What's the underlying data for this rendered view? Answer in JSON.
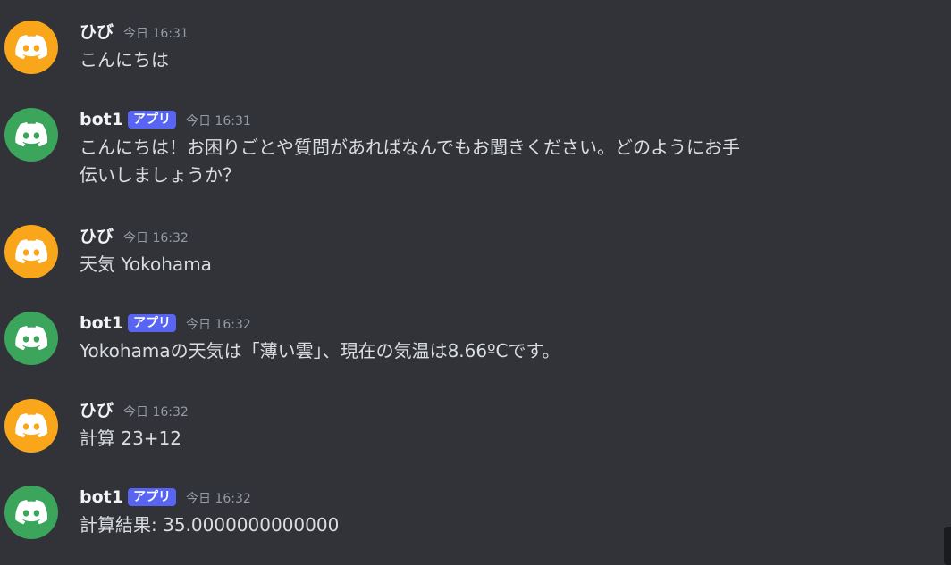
{
  "colors": {
    "background": "#313338",
    "avatar_orange": "#faa61a",
    "avatar_green": "#3ba55c",
    "badge": "#5865f2"
  },
  "messages": [
    {
      "author": "ひび",
      "is_app": false,
      "badge": "",
      "timestamp": "今日 16:31",
      "avatar_icon": "discord-logo-icon",
      "avatar_color": "#faa61a",
      "lines": [
        "こんにちは"
      ]
    },
    {
      "author": "bot1",
      "is_app": true,
      "badge": "アプリ",
      "timestamp": "今日 16:31",
      "avatar_icon": "discord-logo-icon",
      "avatar_color": "#3ba55c",
      "lines": [
        "こんにちは！お困りごとや質問があればなんでもお聞きください。どのようにお手",
        "伝いしましょうか？"
      ]
    },
    {
      "author": "ひび",
      "is_app": false,
      "badge": "",
      "timestamp": "今日 16:32",
      "avatar_icon": "discord-logo-icon",
      "avatar_color": "#faa61a",
      "lines": [
        "天気 Yokohama"
      ]
    },
    {
      "author": "bot1",
      "is_app": true,
      "badge": "アプリ",
      "timestamp": "今日 16:32",
      "avatar_icon": "discord-logo-icon",
      "avatar_color": "#3ba55c",
      "lines": [
        "Yokohamaの天気は「薄い雲」、現在の気温は8.66ºCです。"
      ]
    },
    {
      "author": "ひび",
      "is_app": false,
      "badge": "",
      "timestamp": "今日 16:32",
      "avatar_icon": "discord-logo-icon",
      "avatar_color": "#faa61a",
      "lines": [
        "計算 23+12"
      ]
    },
    {
      "author": "bot1",
      "is_app": true,
      "badge": "アプリ",
      "timestamp": "今日 16:32",
      "avatar_icon": "discord-logo-icon",
      "avatar_color": "#3ba55c",
      "lines": [
        "計算結果: 35.0000000000000"
      ]
    }
  ]
}
